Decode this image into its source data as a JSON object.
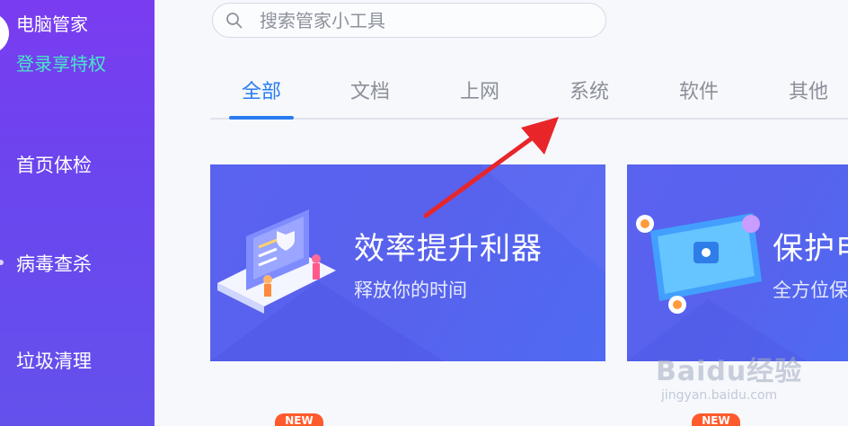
{
  "sidebar": {
    "app_title": "电脑管家",
    "login_link": "登录享特权",
    "nav": [
      {
        "label": "首页体检"
      },
      {
        "label": "病毒查杀"
      },
      {
        "label": "垃圾清理"
      }
    ]
  },
  "search": {
    "placeholder": "搜索管家小工具",
    "value": ""
  },
  "tabs": [
    {
      "label": "全部",
      "active": true
    },
    {
      "label": "文档",
      "active": false
    },
    {
      "label": "上网",
      "active": false
    },
    {
      "label": "系统",
      "active": false
    },
    {
      "label": "软件",
      "active": false
    },
    {
      "label": "其他",
      "active": false
    }
  ],
  "banners": [
    {
      "title": "效率提升利器",
      "subtitle": "释放你的时间"
    },
    {
      "title": "保护电",
      "subtitle": "全方位保"
    }
  ],
  "badges": [
    "NEW",
    "NEW"
  ],
  "watermark": {
    "brand": "Baidu经验",
    "url": "jingyan.baidu.com"
  },
  "colors": {
    "sidebar": "#6a46ee",
    "accent": "#2a7cf0",
    "login": "#48e6c8",
    "banner": "#5862ec",
    "badge": "#ff5a2c",
    "arrow": "#e8262a"
  }
}
